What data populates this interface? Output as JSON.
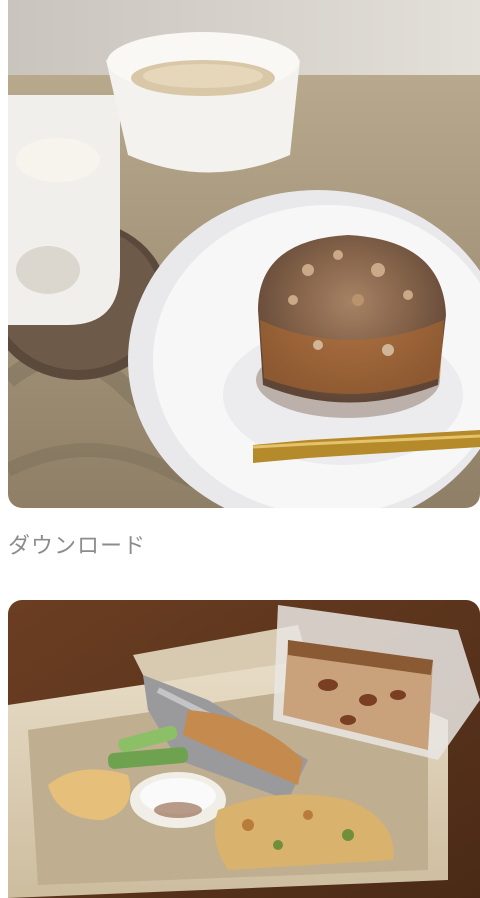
{
  "feed": {
    "items": [
      {
        "kind": "photo",
        "icon": "food-photo-muffin-and-tea"
      },
      {
        "kind": "action",
        "download_label": "ダウンロード"
      },
      {
        "kind": "photo",
        "icon": "food-photo-bento-box-with-pound-cake"
      }
    ]
  }
}
